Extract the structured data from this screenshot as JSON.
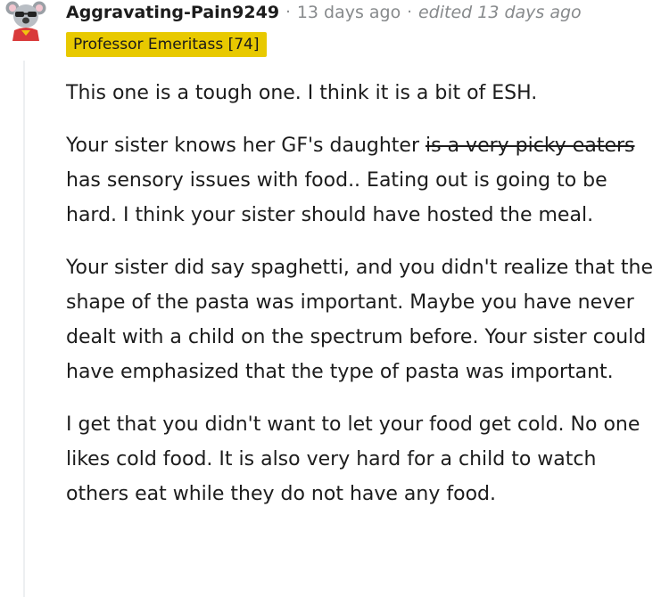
{
  "comment": {
    "author": "Aggravating-Pain9249",
    "separator": "·",
    "time_ago": "13 days ago",
    "edited": "edited 13 days ago",
    "flair": "Professor Emeritass [74]",
    "flair_color": "#e8c900",
    "paragraphs": [
      {
        "text": "This one is a tough one. I think it is a bit of ESH."
      },
      {
        "before": "Your sister knows her GF's daughter ",
        "struck": "is a very picky eaters",
        "after": " has sensory issues with food.. Eating out is going to be hard. I think your sister should have hosted the meal."
      },
      {
        "text": "Your sister did say spaghetti, and you didn't realize that the shape of the pasta was important. Maybe you have never dealt with a child on the spectrum before. Your sister could have emphasized that the type of pasta was important."
      },
      {
        "text": "I get that you didn't want to let your food get cold. No one likes cold food. It is also very hard for a child to watch others eat while they do not have any food."
      }
    ]
  },
  "icons": {
    "avatar": "koala-avatar-icon"
  }
}
